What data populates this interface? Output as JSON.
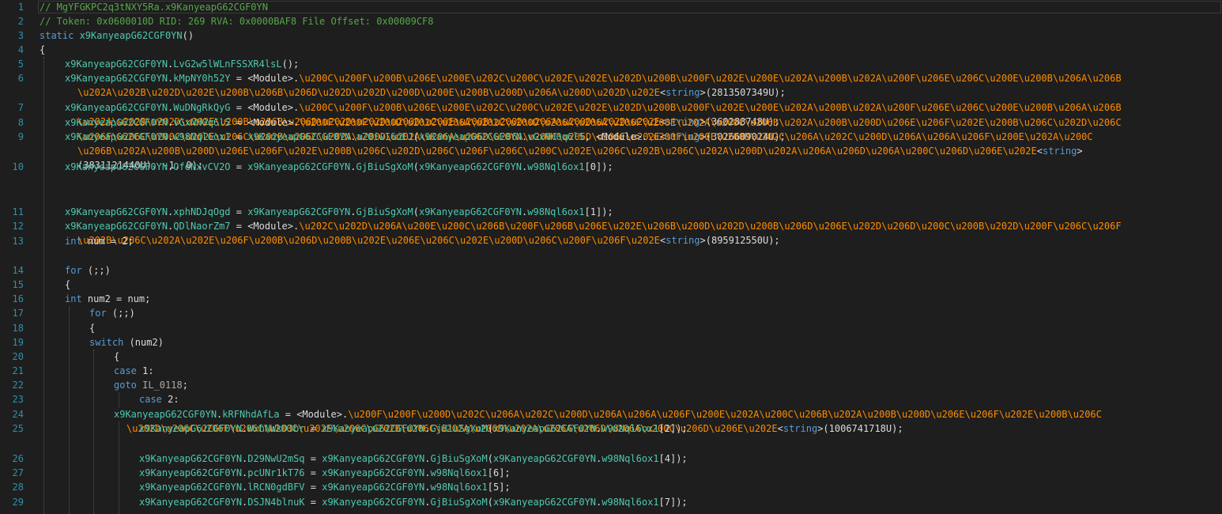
{
  "lines": [
    {
      "n": "1",
      "segs": [
        [
          "cm",
          "// MgYFGKPC2q3tNXY5Ra.x9KanyeapG62CGF0YN"
        ]
      ]
    },
    {
      "n": "2",
      "segs": [
        [
          "cm",
          "// Token: 0x0600010D RID: 269 RVA: 0x0000BAF8 File Offset: 0x00009CF8"
        ]
      ]
    },
    {
      "n": "3",
      "segs": [
        [
          "kw",
          "static "
        ],
        [
          "ty",
          "x9KanyeapG62CGF0YN"
        ],
        [
          "id",
          "()"
        ]
      ]
    },
    {
      "n": "4",
      "segs": [
        [
          "id",
          "{"
        ]
      ]
    },
    {
      "n": "5",
      "segs": [
        [
          "ty",
          "x9KanyeapG62CGF0YN"
        ],
        [
          "id",
          "."
        ],
        [
          "ty",
          "LvG2w5lWLnFSSXR4lsL"
        ],
        [
          "id",
          "();"
        ]
      ]
    },
    {
      "n": "6",
      "segs": [
        [
          "ty",
          "x9KanyeapG62CGF0YN"
        ],
        [
          "id",
          "."
        ],
        [
          "ty",
          "kMpNY0h52Y"
        ],
        [
          "id",
          " = <Module>."
        ],
        [
          "es",
          "\\u200C\\u200F\\u200B\\u206E\\u200E\\u202C\\u200C\\u202E\\u202E\\u202D\\u200B\\u200F\\u202E\\u200E\\u202A\\u200B\\u202A\\u200F\\u206E\\u206C\\u200E\\u200B\\u206A\\u206B"
        ]
      ],
      "cont": [
        [
          [
            "es",
            "\\u202A\\u202B\\u202D\\u202E\\u200B\\u206B\\u206D\\u202D\\u202D\\u200D\\u200E\\u200B\\u200D\\u206A\\u200D\\u202D\\u202E"
          ],
          [
            "id",
            "<"
          ],
          [
            "kw",
            "string"
          ],
          [
            "id",
            ">(2813507349U);"
          ]
        ]
      ]
    },
    {
      "n": "7",
      "segs": [
        [
          "ty",
          "x9KanyeapG62CGF0YN"
        ],
        [
          "id",
          "."
        ],
        [
          "ty",
          "WuDNgRkQyG"
        ],
        [
          "id",
          " = <Module>."
        ],
        [
          "es",
          "\\u200C\\u200F\\u200B\\u206E\\u200E\\u202C\\u200C\\u202E\\u202E\\u202D\\u200B\\u200F\\u202E\\u200E\\u202A\\u200B\\u202A\\u200F\\u206E\\u206C\\u200E\\u200B\\u206A\\u206B"
        ]
      ],
      "cont": [
        [
          [
            "es",
            "\\u202A\\u202B\\u202D\\u202E\\u200B\\u206B\\u206D\\u202D\\u202D\\u200D\\u200E\\u200B\\u200D\\u206A\\u200D\\u202D\\u202E"
          ],
          [
            "id",
            "<"
          ],
          [
            "kw",
            "string"
          ],
          [
            "id",
            ">(360288748U);"
          ]
        ]
      ]
    },
    {
      "n": "8",
      "segs": [
        [
          "ty",
          "x9KanyeapG62CGF0YN"
        ],
        [
          "id",
          "."
        ],
        [
          "ty",
          "vGxNH0q6l5"
        ],
        [
          "id",
          " = <Module>."
        ],
        [
          "es",
          "\\u200F\\u200F\\u200D\\u202C\\u206A\\u202C\\u200D\\u206A\\u206A\\u206F\\u200E\\u202A\\u200C\\u206B\\u202A\\u200B\\u200D\\u206E\\u206F\\u202E\\u200B\\u206C\\u202D\\u206C"
        ]
      ],
      "cont": [
        [
          [
            "es",
            "\\u206F\\u206C\\u200C\\u202E\\u206C\\u202B\\u206C\\u202A\\u200D\\u202A\\u206A\\u206D\\u206A\\u200C\\u206D\\u206E\\u202E"
          ],
          [
            "id",
            "<"
          ],
          [
            "kw",
            "string"
          ],
          [
            "id",
            ">(3026609024U);"
          ]
        ]
      ]
    },
    {
      "n": "9",
      "segs": [
        [
          "ty",
          "x9KanyeapG62CGF0YN"
        ],
        [
          "id",
          "."
        ],
        [
          "ty",
          "w98Nql6ox1"
        ],
        [
          "id",
          " = "
        ],
        [
          "ty",
          "x9KanyeapG62CGF0YN"
        ],
        [
          "id",
          "."
        ],
        [
          "ty",
          "aZ0iwI6nEJ"
        ],
        [
          "id",
          "("
        ],
        [
          "ty",
          "x9KanyeapG62CGF0YN"
        ],
        [
          "id",
          "."
        ],
        [
          "ty",
          "vGxNH0q6l5"
        ],
        [
          "id",
          ", <Module>."
        ],
        [
          "es",
          "\\u200F\\u200F\\u200D\\u202C\\u206A\\u202C\\u200D\\u206A\\u206A\\u206F\\u200E\\u202A\\u200C"
        ]
      ],
      "cont": [
        [
          [
            "es",
            "\\u206B\\u202A\\u200B\\u200D\\u206E\\u206F\\u202E\\u200B\\u206C\\u202D\\u206C\\u206F\\u206C\\u200C\\u202E\\u206C\\u202B\\u206C\\u202A\\u200D\\u202A\\u206A\\u206D\\u206A\\u200C\\u206D\\u206E\\u202E"
          ],
          [
            "id",
            "<"
          ],
          [
            "kw",
            "string"
          ],
          [
            "id",
            ">"
          ]
        ],
        [
          [
            "id",
            "(3831121440U), -1, 0);"
          ]
        ]
      ]
    },
    {
      "n": "10",
      "segs": [
        [
          "ty",
          "x9KanyeapG62CGF0YN"
        ],
        [
          "id",
          "."
        ],
        [
          "ty",
          "OfeNxvCV2O"
        ],
        [
          "id",
          " = "
        ],
        [
          "ty",
          "x9KanyeapG62CGF0YN"
        ],
        [
          "id",
          "."
        ],
        [
          "ty",
          "GjBiuSgXoM"
        ],
        [
          "id",
          "("
        ],
        [
          "ty",
          "x9KanyeapG62CGF0YN"
        ],
        [
          "id",
          "."
        ],
        [
          "ty",
          "w98Nql6ox1"
        ],
        [
          "id",
          "[0]);"
        ]
      ]
    },
    {
      "n": "11",
      "segs": [
        [
          "ty",
          "x9KanyeapG62CGF0YN"
        ],
        [
          "id",
          "."
        ],
        [
          "ty",
          "xphNDJqOgd"
        ],
        [
          "id",
          " = "
        ],
        [
          "ty",
          "x9KanyeapG62CGF0YN"
        ],
        [
          "id",
          "."
        ],
        [
          "ty",
          "GjBiuSgXoM"
        ],
        [
          "id",
          "("
        ],
        [
          "ty",
          "x9KanyeapG62CGF0YN"
        ],
        [
          "id",
          "."
        ],
        [
          "ty",
          "w98Nql6ox1"
        ],
        [
          "id",
          "[1]);"
        ]
      ]
    },
    {
      "n": "12",
      "segs": [
        [
          "ty",
          "x9KanyeapG62CGF0YN"
        ],
        [
          "id",
          "."
        ],
        [
          "ty",
          "QDlNaorZm7"
        ],
        [
          "id",
          " = <Module>."
        ],
        [
          "es",
          "\\u202C\\u202D\\u206A\\u200E\\u200C\\u206B\\u200F\\u206B\\u206E\\u202E\\u206B\\u200D\\u202D\\u200B\\u206D\\u206E\\u202D\\u206D\\u200C\\u200B\\u202D\\u200F\\u206C\\u206F"
        ]
      ],
      "cont": [
        [
          [
            "es",
            "\\u202B\\u206C\\u202A\\u202E\\u206F\\u200B\\u206D\\u200B\\u202E\\u206E\\u206C\\u202E\\u200D\\u206C\\u200F\\u206F\\u202E"
          ],
          [
            "id",
            "<"
          ],
          [
            "kw",
            "string"
          ],
          [
            "id",
            ">(895912550U);"
          ]
        ]
      ]
    },
    {
      "n": "13",
      "segs": [
        [
          "kw",
          "int "
        ],
        [
          "id",
          "num = 2;"
        ]
      ]
    },
    {
      "n": "14",
      "segs": [
        [
          "kw",
          "for "
        ],
        [
          "id",
          "(;;)"
        ]
      ]
    },
    {
      "n": "15",
      "segs": [
        [
          "id",
          "{"
        ]
      ]
    },
    {
      "n": "16",
      "segs": [
        [
          "kw",
          "int "
        ],
        [
          "id",
          "num2 = num;"
        ]
      ]
    },
    {
      "n": "17",
      "segs": [
        [
          "kw",
          "for "
        ],
        [
          "id",
          "(;;)"
        ]
      ]
    },
    {
      "n": "18",
      "segs": [
        [
          "id",
          "{"
        ]
      ]
    },
    {
      "n": "19",
      "segs": [
        [
          "kw",
          "switch "
        ],
        [
          "id",
          "(num2)"
        ]
      ]
    },
    {
      "n": "20",
      "segs": [
        [
          "id",
          "{"
        ]
      ]
    },
    {
      "n": "21",
      "segs": [
        [
          "kw",
          "case "
        ],
        [
          "id",
          "1:"
        ]
      ]
    },
    {
      "n": "22",
      "segs": [
        [
          "kw",
          "goto "
        ],
        [
          "lb",
          "IL_0118"
        ],
        [
          "id",
          ";"
        ]
      ]
    },
    {
      "n": "23",
      "segs": [
        [
          "kw",
          "case "
        ],
        [
          "id",
          "2:"
        ]
      ]
    },
    {
      "n": "24",
      "segs": [
        [
          "ty",
          "x9KanyeapG62CGF0YN"
        ],
        [
          "id",
          "."
        ],
        [
          "ty",
          "kRFNhdAfLa"
        ],
        [
          "id",
          " = <Module>."
        ],
        [
          "es",
          "\\u200F\\u200F\\u200D\\u202C\\u206A\\u202C\\u200D\\u206A\\u206A\\u206F\\u200E\\u202A\\u200C\\u206B\\u202A\\u200B\\u200D\\u206E\\u206F\\u202E\\u200B\\u206C"
        ]
      ],
      "cont": [
        [
          [
            "es",
            "\\u202D\\u206C\\u206F\\u206C\\u200C\\u202E\\u206C\\u202B\\u206C\\u202A\\u200D\\u202A\\u206A\\u206D\\u206A\\u200C\\u206D\\u206E\\u202E"
          ],
          [
            "id",
            "<"
          ],
          [
            "kw",
            "string"
          ],
          [
            "id",
            ">(1006741718U);"
          ]
        ]
      ]
    },
    {
      "n": "25",
      "segs": [
        [
          "ty",
          "x9KanyeapG62CGF0YN"
        ],
        [
          "id",
          "."
        ],
        [
          "ty",
          "WxhNWkD3br"
        ],
        [
          "id",
          " = "
        ],
        [
          "ty",
          "x9KanyeapG62CGF0YN"
        ],
        [
          "id",
          "."
        ],
        [
          "ty",
          "GjBiuSgXoM"
        ],
        [
          "id",
          "("
        ],
        [
          "ty",
          "x9KanyeapG62CGF0YN"
        ],
        [
          "id",
          "."
        ],
        [
          "ty",
          "w98Nql6ox1"
        ],
        [
          "id",
          "[2]);"
        ]
      ]
    },
    {
      "n": "26",
      "segs": [
        [
          "ty",
          "x9KanyeapG62CGF0YN"
        ],
        [
          "id",
          "."
        ],
        [
          "ty",
          "D29NwU2mSq"
        ],
        [
          "id",
          " = "
        ],
        [
          "ty",
          "x9KanyeapG62CGF0YN"
        ],
        [
          "id",
          "."
        ],
        [
          "ty",
          "GjBiuSgXoM"
        ],
        [
          "id",
          "("
        ],
        [
          "ty",
          "x9KanyeapG62CGF0YN"
        ],
        [
          "id",
          "."
        ],
        [
          "ty",
          "w98Nql6ox1"
        ],
        [
          "id",
          "[4]);"
        ]
      ]
    },
    {
      "n": "27",
      "segs": [
        [
          "ty",
          "x9KanyeapG62CGF0YN"
        ],
        [
          "id",
          "."
        ],
        [
          "ty",
          "pcUNr1kT76"
        ],
        [
          "id",
          " = "
        ],
        [
          "ty",
          "x9KanyeapG62CGF0YN"
        ],
        [
          "id",
          "."
        ],
        [
          "ty",
          "w98Nql6ox1"
        ],
        [
          "id",
          "[6];"
        ]
      ]
    },
    {
      "n": "28",
      "segs": [
        [
          "ty",
          "x9KanyeapG62CGF0YN"
        ],
        [
          "id",
          "."
        ],
        [
          "ty",
          "lRCN0gdBFV"
        ],
        [
          "id",
          " = "
        ],
        [
          "ty",
          "x9KanyeapG62CGF0YN"
        ],
        [
          "id",
          "."
        ],
        [
          "ty",
          "w98Nql6ox1"
        ],
        [
          "id",
          "[5];"
        ]
      ]
    },
    {
      "n": "29",
      "segs": [
        [
          "ty",
          "x9KanyeapG62CGF0YN"
        ],
        [
          "id",
          "."
        ],
        [
          "ty",
          "DSJN4blnuK"
        ],
        [
          "id",
          " = "
        ],
        [
          "ty",
          "x9KanyeapG62CGF0YN"
        ],
        [
          "id",
          "."
        ],
        [
          "ty",
          "GjBiuSgXoM"
        ],
        [
          "id",
          "("
        ],
        [
          "ty",
          "x9KanyeapG62CGF0YN"
        ],
        [
          "id",
          "."
        ],
        [
          "ty",
          "w98Nql6ox1"
        ],
        [
          "id",
          "[7]);"
        ]
      ]
    }
  ]
}
